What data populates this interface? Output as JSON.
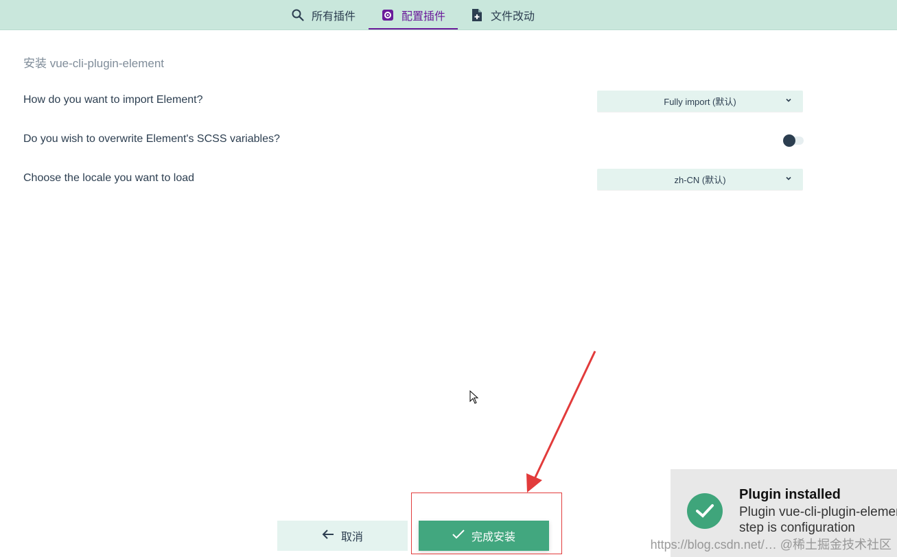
{
  "tabs": [
    {
      "label": "所有插件",
      "icon": "search-icon"
    },
    {
      "label": "配置插件",
      "icon": "gear-icon",
      "active": true
    },
    {
      "label": "文件改动",
      "icon": "file-plus-icon"
    }
  ],
  "form": {
    "title": "安装 vue-cli-plugin-element",
    "questions": [
      {
        "label": "How do you want to import Element?",
        "type": "select",
        "value": "Fully import (默认)"
      },
      {
        "label": "Do you wish to overwrite Element's SCSS variables?",
        "type": "toggle",
        "value": false
      },
      {
        "label": "Choose the locale you want to load",
        "type": "select",
        "value": "zh-CN (默认)"
      }
    ]
  },
  "actions": {
    "cancel_label": "取消",
    "finish_label": "完成安装"
  },
  "notification": {
    "title": "Plugin installed",
    "body": "Plugin vue-cli-plugin-element installed, next step is configuration"
  },
  "watermark": "https://blog.csdn.net/… @稀土掘金技术社区",
  "colors": {
    "tabbar": "#c9e7dc",
    "active_tab": "#6a1b9a",
    "primary": "#42a77f",
    "annotation": "#e23b3b"
  }
}
